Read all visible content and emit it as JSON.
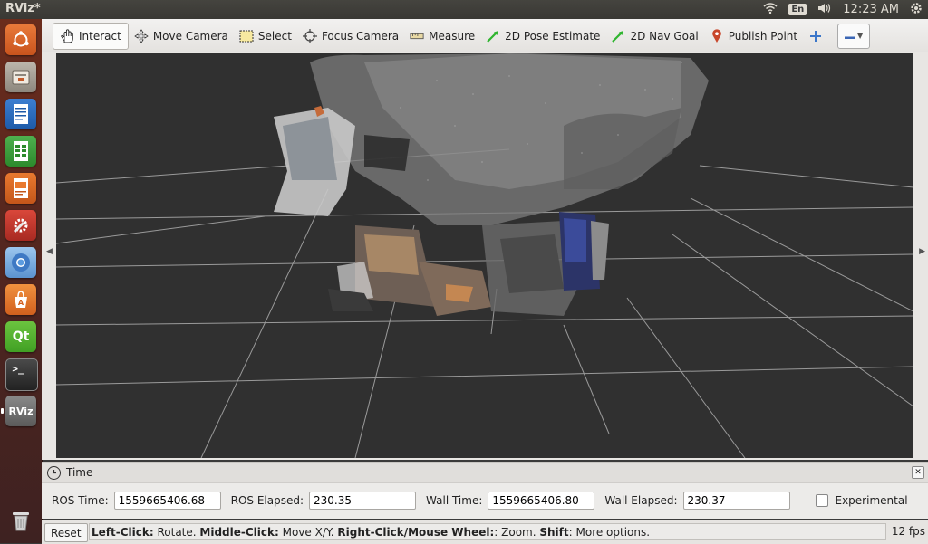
{
  "topbar": {
    "app_title": "RViz*",
    "language": "En",
    "clock": "12:23 AM"
  },
  "launcher": {
    "items": [
      {
        "name": "dash-home",
        "label": ""
      },
      {
        "name": "files",
        "label": ""
      },
      {
        "name": "writer",
        "label": ""
      },
      {
        "name": "calc",
        "label": ""
      },
      {
        "name": "impress",
        "label": ""
      },
      {
        "name": "settings",
        "label": ""
      },
      {
        "name": "chromium",
        "label": ""
      },
      {
        "name": "software-center",
        "label": ""
      },
      {
        "name": "qt-creator",
        "label": "Qt"
      },
      {
        "name": "terminal",
        "label": ">_"
      },
      {
        "name": "rviz",
        "label": "RViz"
      },
      {
        "name": "trash",
        "label": ""
      }
    ]
  },
  "toolbar": {
    "interact": "Interact",
    "move_camera": "Move Camera",
    "select": "Select",
    "focus_camera": "Focus Camera",
    "measure": "Measure",
    "pose_estimate": "2D Pose Estimate",
    "nav_goal": "2D Nav Goal",
    "publish_point": "Publish Point"
  },
  "time_panel": {
    "title": "Time",
    "ros_time_label": "ROS Time:",
    "ros_time_value": "1559665406.68",
    "ros_elapsed_label": "ROS Elapsed:",
    "ros_elapsed_value": "230.35",
    "wall_time_label": "Wall Time:",
    "wall_time_value": "1559665406.80",
    "wall_elapsed_label": "Wall Elapsed:",
    "wall_elapsed_value": "230.37",
    "experimental_label": "Experimental"
  },
  "statusbar": {
    "reset_label": "Reset",
    "help_parts": [
      {
        "bold": "Left-Click:",
        "text": " Rotate. "
      },
      {
        "bold": "Middle-Click:",
        "text": " Move X/Y. "
      },
      {
        "bold": "Right-Click/Mouse Wheel:",
        "text": ": Zoom. "
      },
      {
        "bold": "Shift",
        "text": ": More options."
      }
    ],
    "fps": "12 fps"
  },
  "colors": {
    "viewport_background": "#303030",
    "grid": "#a0a0a0",
    "pose_arrow": "#2fb52f",
    "publish_pin": "#c8462a",
    "launcher_background": "#4b2420"
  }
}
